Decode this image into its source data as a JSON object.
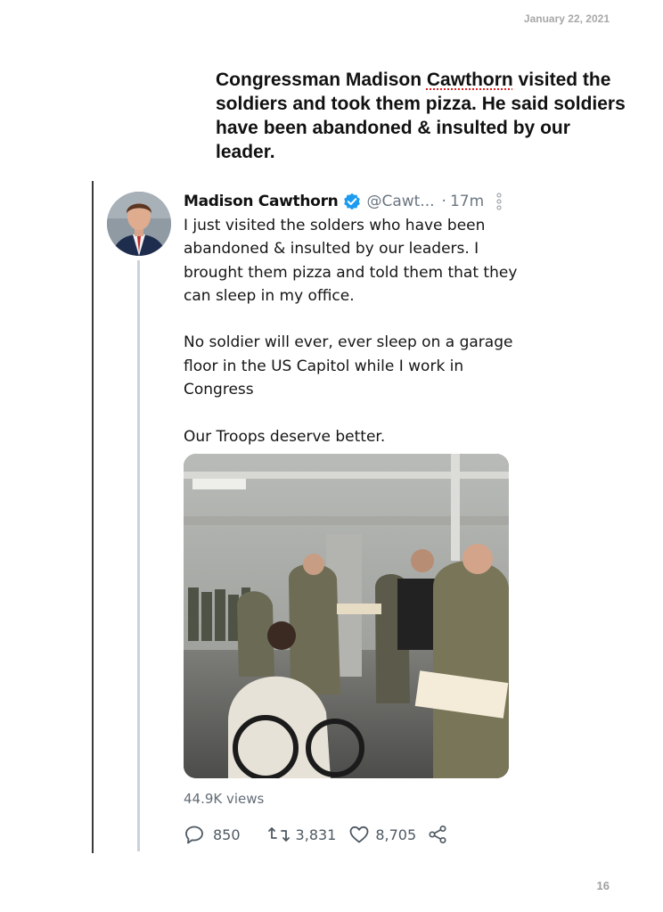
{
  "page": {
    "date": "January 22, 2021",
    "headline": {
      "before": "Congressman Madison ",
      "flagged_word": "Cawthorn",
      "after": " visited the soldiers and took them pizza. He said soldiers have been abandoned & insulted by our leader."
    },
    "page_number": "16"
  },
  "tweet": {
    "display_name": "Madison Cawthorn",
    "handle": "@Cawt...",
    "separator": "·",
    "time": "17m",
    "paragraphs": [
      "I just visited the solders who have been abandoned & insulted by our leaders. I brought them pizza and told them that they can sleep in my office.",
      "No soldier will ever, ever sleep on a garage floor in the US Capitol while I work in Congress",
      "Our Troops deserve better."
    ],
    "views": "44.9K views",
    "replies": "850",
    "retweets": "3,831",
    "likes": "8,705"
  },
  "colors": {
    "verified": "#1d9bf0",
    "text": "#151515",
    "muted": "#6b7680",
    "thread_line": "#c9d2db",
    "spellcheck": "#dd2222"
  },
  "icons": [
    "verified-badge-icon",
    "more-options-icon",
    "reply-icon",
    "retweet-icon",
    "like-icon",
    "share-icon"
  ]
}
